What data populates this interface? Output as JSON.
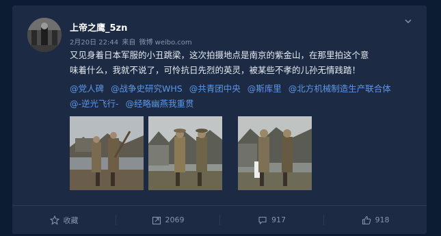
{
  "post": {
    "username": "上帝之鹰_5zn",
    "date": "2月20日 22:44",
    "via": "来自",
    "source": "微博 weibo.com",
    "text_line1": "又见身着日本军服的小丑跳梁，这次拍摄地点是南京的紫金山，在那里拍这个意",
    "text_line2": "味着什么，我就不说了，可怜抗日先烈的英灵，被某些不孝的儿孙无情践踏！",
    "mentions": [
      "@党人碑",
      "@战争史研究WHS",
      "@共青团中央",
      "@斯库里",
      "@北方机械制造生产联合体",
      "@-逆光飞行-",
      "@经略幽燕我重贯"
    ]
  },
  "actions": {
    "favorite": {
      "icon": "star-icon",
      "label": "收藏"
    },
    "repost": {
      "icon": "repost-icon",
      "count": "2069"
    },
    "comment": {
      "icon": "comment-icon",
      "count": "917"
    },
    "like": {
      "icon": "thumbs-up-icon",
      "count": "918"
    }
  },
  "colors": {
    "page_bg": "#0c1c33",
    "card_bg": "#1c2a44",
    "link": "#5d97e6",
    "muted": "#8796ad"
  }
}
